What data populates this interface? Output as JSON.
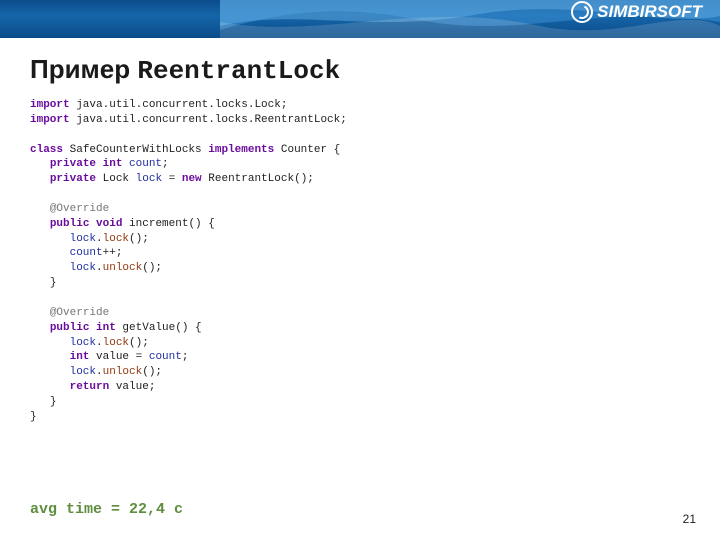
{
  "brand": {
    "prefix": "S",
    "rest": "IMBIR",
    "suffix": "SOFT"
  },
  "title": {
    "ru": "Пример ",
    "mono": "ReentrantLock"
  },
  "code": {
    "imp1": {
      "kw": "import",
      "rest": " java.util.concurrent.locks.Lock;"
    },
    "imp2": {
      "kw": "import",
      "rest": " java.util.concurrent.locks.ReentrantLock;"
    },
    "cls": {
      "kw1": "class",
      "name": " SafeCounterWithLocks ",
      "kw2": "implements",
      "rest": " Counter {"
    },
    "f1": {
      "pad": "   ",
      "kw": "private int ",
      "name": "count",
      "rest": ";"
    },
    "f2": {
      "pad": "   ",
      "kw1": "private",
      "type": " Lock ",
      "name": "lock",
      "eq": " = ",
      "kw2": "new",
      "rest": " ReentrantLock();"
    },
    "ov": {
      "pad": "   ",
      "txt": "@Override"
    },
    "m1": {
      "pad": "   ",
      "kw": "public void",
      "name": " increment() {"
    },
    "l_lock": {
      "pad": "      ",
      "obj": "lock",
      "dot": ".",
      "call": "lock",
      "rest": "();"
    },
    "l_inc": {
      "pad": "      ",
      "obj": "count",
      "rest": "++;"
    },
    "l_unlock": {
      "pad": "      ",
      "obj": "lock",
      "dot": ".",
      "call": "unlock",
      "rest": "();"
    },
    "close_m": {
      "pad": "   ",
      "txt": "}"
    },
    "m2": {
      "pad": "   ",
      "kw": "public int",
      "name": " getValue() {"
    },
    "l_val": {
      "pad": "      ",
      "kw": "int",
      "mid": " value = ",
      "obj": "count",
      "rest": ";"
    },
    "l_ret": {
      "pad": "      ",
      "kw": "return",
      "rest": " value;"
    },
    "close_c": {
      "txt": "}"
    }
  },
  "footer": "avg time = 22,4 с",
  "page": "21"
}
